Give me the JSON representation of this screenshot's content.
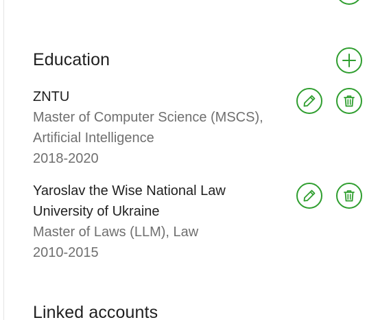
{
  "education": {
    "title": "Education",
    "add_button_icon": "plus-icon",
    "entries": [
      {
        "school": "ZNTU",
        "degree": "Master of Computer Science (MSCS), Artificial Intelligence",
        "years": "2018-2020",
        "edit_icon": "pencil-icon",
        "delete_icon": "trash-icon"
      },
      {
        "school": "Yaroslav the Wise National Law University of Ukraine",
        "degree": "Master of Laws (LLM), Law",
        "years": "2010-2015",
        "edit_icon": "pencil-icon",
        "delete_icon": "trash-icon"
      }
    ]
  },
  "linked_accounts": {
    "title": "Linked accounts"
  },
  "colors": {
    "accent": "#2f9e2f",
    "text_primary": "#1f1f1f",
    "text_secondary": "#6f6f6f"
  }
}
